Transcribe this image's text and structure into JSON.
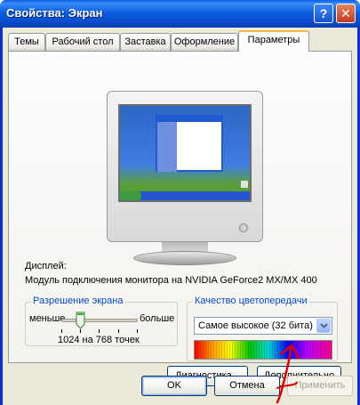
{
  "window": {
    "title": "Свойства: Экран",
    "help_label": "?",
    "close_label": "✕"
  },
  "tabs": [
    {
      "label": "Темы"
    },
    {
      "label": "Рабочий стол"
    },
    {
      "label": "Заставка"
    },
    {
      "label": "Оформление"
    },
    {
      "label": "Параметры",
      "active": true
    }
  ],
  "display": {
    "label": "Дисплей:",
    "value": "Модуль подключения монитора на NVIDIA GeForce2 MX/MX 400"
  },
  "resolution": {
    "group_title": "Разрешение экрана",
    "less_label": "меньше",
    "more_label": "больше",
    "value_text": "1024 на 768 точек",
    "slider_level": 0.25
  },
  "color_quality": {
    "group_title": "Качество цветопередачи",
    "selected": "Самое высокое (32 бита)"
  },
  "panel_buttons": {
    "troubleshoot": "Диагностика...",
    "advanced": "Дополнительно"
  },
  "dialog_buttons": {
    "ok": "OK",
    "cancel": "Отмена",
    "apply": "Применить"
  },
  "colors": {
    "titlebar": "#0a5fe6",
    "dialog_bg": "#ece9d8",
    "group_title": "#0046d5",
    "annotation": "#e00000"
  }
}
